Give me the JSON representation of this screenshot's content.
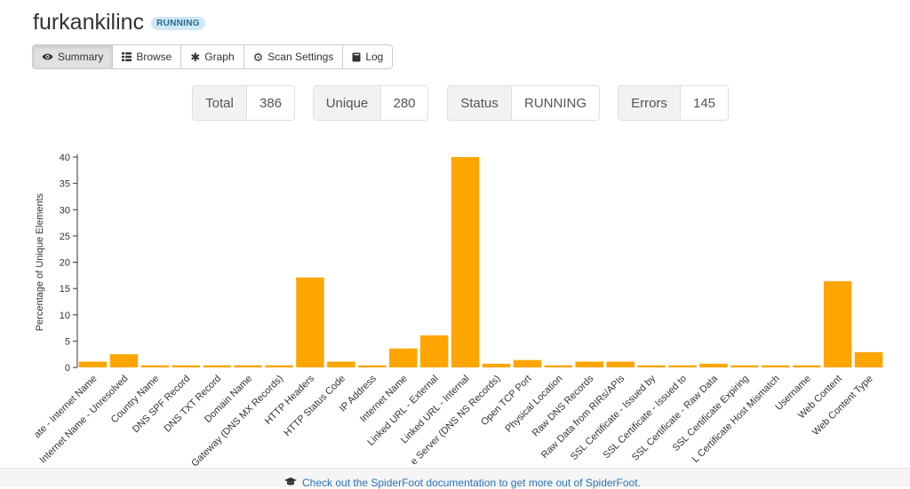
{
  "header": {
    "title": "furkankilinc",
    "status_badge": "RUNNING"
  },
  "tabs": [
    {
      "label": "Summary",
      "icon": "eye-icon",
      "active": true
    },
    {
      "label": "Browse",
      "icon": "list-icon",
      "active": false
    },
    {
      "label": "Graph",
      "icon": "asterisk-icon",
      "active": false
    },
    {
      "label": "Scan Settings",
      "icon": "gear-icon",
      "active": false
    },
    {
      "label": "Log",
      "icon": "book-icon",
      "active": false
    }
  ],
  "stats": [
    {
      "label": "Total",
      "value": "386"
    },
    {
      "label": "Unique",
      "value": "280"
    },
    {
      "label": "Status",
      "value": "RUNNING"
    },
    {
      "label": "Errors",
      "value": "145"
    }
  ],
  "colors": {
    "bar": "#ffa500",
    "accent": "#2a73b8",
    "badge_bg": "#cfe8f4",
    "badge_text": "#2b6a8f"
  },
  "chart_data": {
    "type": "bar",
    "ylabel": "Percentage of Unique Elements",
    "ylim": [
      0,
      40
    ],
    "yticks": [
      0,
      5,
      10,
      15,
      20,
      25,
      30,
      35,
      40
    ],
    "grid": false,
    "categories": [
      "ate - Internet Name",
      "Internet Name - Unresolved",
      "Country Name",
      "DNS SPF Record",
      "DNS TXT Record",
      "Domain Name",
      "Gateway (DNS MX Records)",
      "HTTP Headers",
      "HTTP Status Code",
      "IP Address",
      "Internet Name",
      "Linked URL - External",
      "Linked URL - Internal",
      "e Server (DNS NS Records)",
      "Open TCP Port",
      "Physical Location",
      "Raw DNS Records",
      "Raw Data from RIRs/APIs",
      "SSL Certificate - Issued by",
      "SSL Certificate - Issued to",
      "SSL Certificate - Raw Data",
      "SSL Certificate Expiring",
      "L Certificate Host Mismatch",
      "Username",
      "Web Content",
      "Web Content Type"
    ],
    "values": [
      1.1,
      2.5,
      0.4,
      0.4,
      0.4,
      0.4,
      0.4,
      17.1,
      1.1,
      0.4,
      3.6,
      6.1,
      40,
      0.7,
      1.4,
      0.4,
      1.1,
      1.1,
      0.4,
      0.4,
      0.7,
      0.4,
      0.4,
      0.4,
      16.4,
      2.9
    ]
  },
  "footer": {
    "text": "Check out the SpiderFoot documentation to get more out of SpiderFoot.",
    "icon": "graduation-cap-icon"
  }
}
